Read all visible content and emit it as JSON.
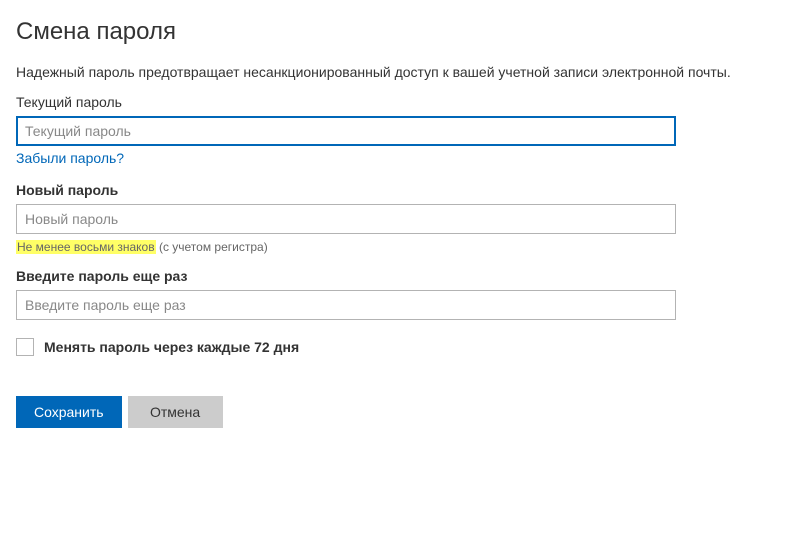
{
  "page": {
    "title": "Смена пароля",
    "description": "Надежный пароль предотвращает несанкционированный доступ к вашей учетной записи электронной почты."
  },
  "currentPassword": {
    "label": "Текущий пароль",
    "placeholder": "Текущий пароль",
    "value": "",
    "forgotLink": "Забыли пароль?"
  },
  "newPassword": {
    "label": "Новый пароль",
    "placeholder": "Новый пароль",
    "value": "",
    "hintHighlight": "Не менее восьми знаков",
    "hintRest": " (с учетом регистра)"
  },
  "confirmPassword": {
    "label": "Введите пароль еще раз",
    "placeholder": "Введите пароль еще раз",
    "value": ""
  },
  "periodicChange": {
    "checked": false,
    "label": "Менять пароль через каждые 72 дня"
  },
  "buttons": {
    "save": "Сохранить",
    "cancel": "Отмена"
  }
}
